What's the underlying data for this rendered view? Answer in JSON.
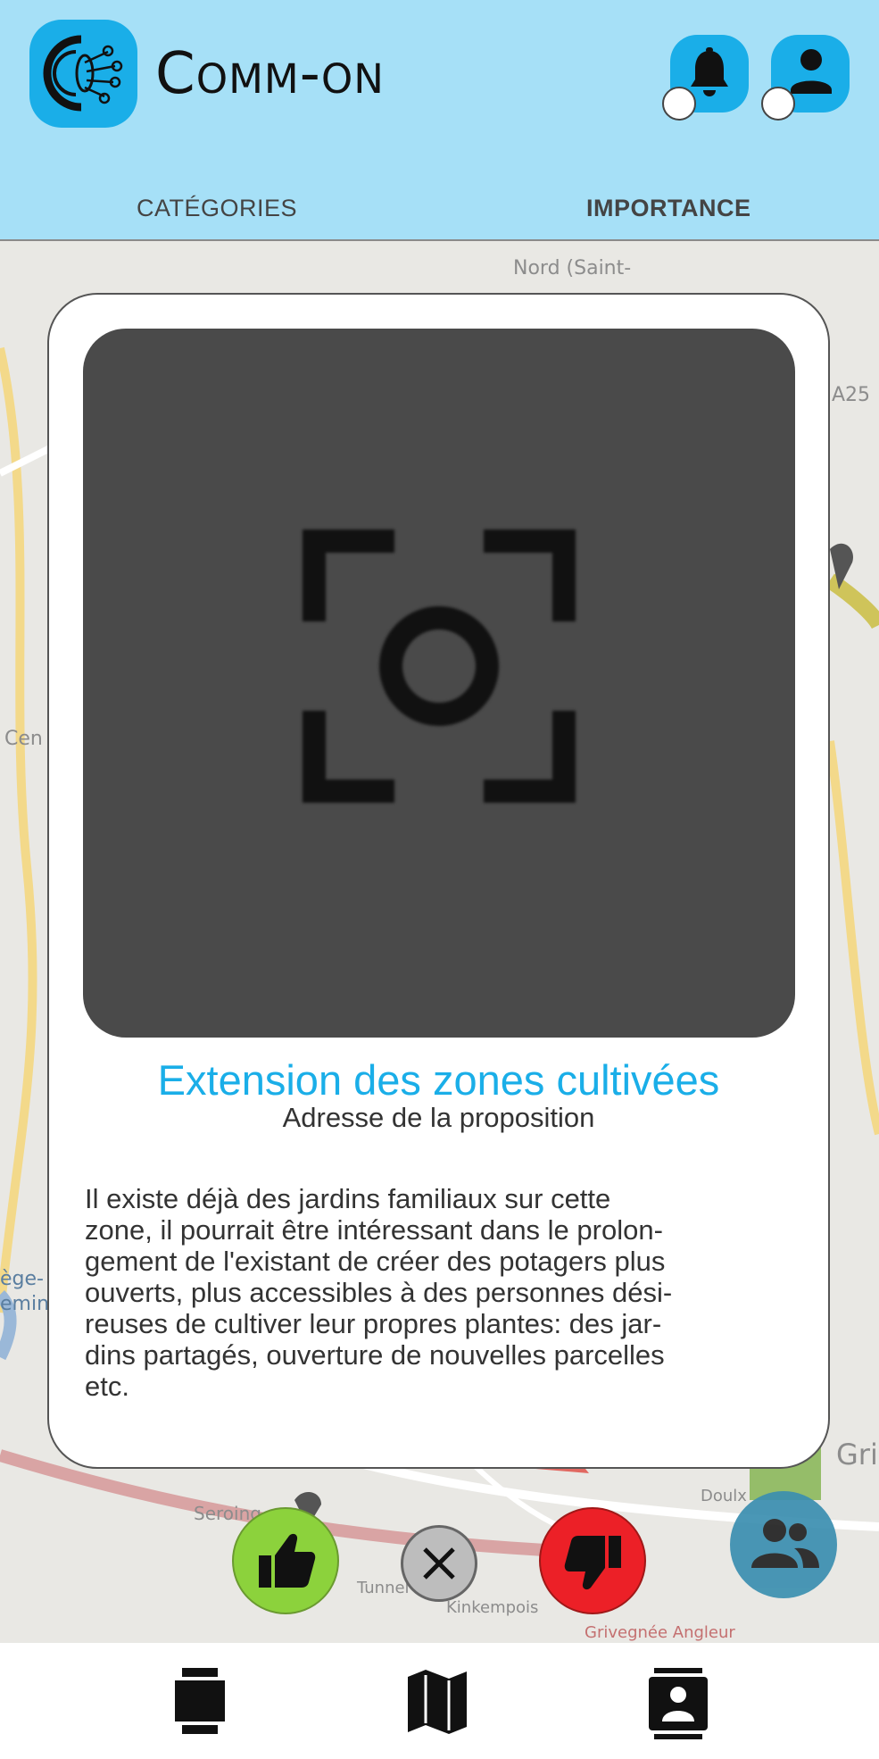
{
  "header": {
    "app_name": "Comm-on",
    "tabs": [
      {
        "label": "CATÉGORIES"
      },
      {
        "label": "IMPORTANCE"
      }
    ]
  },
  "map": {
    "labels": [
      "Nord (Saint-",
      "A25",
      "Cen",
      "Gri",
      "Seroing",
      "Tunnel",
      "Kinkempois",
      "Grivegnée Angleur",
      "Doulx",
      "ège-",
      "emin"
    ]
  },
  "proposal": {
    "title": "Extension des zones cultivées",
    "subtitle": "Adresse de la proposition",
    "description": "Il existe déjà des jardins familiaux sur cette\nzone, il pourrait être intéressant dans le prolon-\ngement de l'existant de créer des potagers plus\nouverts, plus accessibles à des personnes dési-\nreuses de cultiver leur propres plantes: des jar-\ndins partagés, ouverture de nouvelles parcelles\netc."
  },
  "actions": {
    "like_icon": "thumbs-up-icon",
    "close_icon": "close-icon",
    "dislike_icon": "thumbs-down-icon",
    "group_icon": "group-icon"
  },
  "bottom_nav": {
    "items": [
      "proposals-icon",
      "map-icon",
      "contacts-icon"
    ]
  },
  "colors": {
    "header_bg": "#a6e0f7",
    "accent": "#1aaee8",
    "like": "#8cd23c",
    "dislike": "#ec2027",
    "close": "#bdbdbd",
    "group": "#3b8fb0"
  }
}
